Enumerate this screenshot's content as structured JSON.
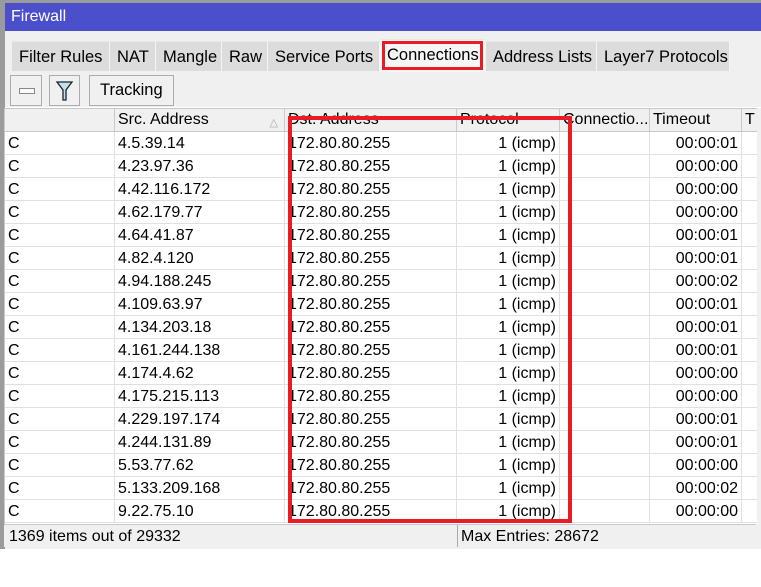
{
  "window": {
    "title": "Firewall"
  },
  "tabs": [
    {
      "label": "Filter Rules",
      "active": false
    },
    {
      "label": "NAT",
      "active": false
    },
    {
      "label": "Mangle",
      "active": false
    },
    {
      "label": "Raw",
      "active": false
    },
    {
      "label": "Service Ports",
      "active": false
    },
    {
      "label": "Connections",
      "active": true
    },
    {
      "label": "Address Lists",
      "active": false
    },
    {
      "label": "Layer7 Protocols",
      "active": false
    }
  ],
  "toolbar": {
    "remove_icon": "minus-icon",
    "filter_icon": "funnel-icon",
    "tracking_label": "Tracking"
  },
  "table": {
    "columns": [
      "",
      "Src. Address",
      "Dst. Address",
      "Protocol",
      "Connectio...",
      "Timeout",
      "T"
    ],
    "sorted_column": "Src. Address",
    "rows": [
      {
        "flag": "C",
        "src": "4.5.39.14",
        "dst": "172.80.80.255",
        "proto": "1 (icmp)",
        "conn": "",
        "timeout": "00:00:01"
      },
      {
        "flag": "C",
        "src": "4.23.97.36",
        "dst": "172.80.80.255",
        "proto": "1 (icmp)",
        "conn": "",
        "timeout": "00:00:00"
      },
      {
        "flag": "C",
        "src": "4.42.116.172",
        "dst": "172.80.80.255",
        "proto": "1 (icmp)",
        "conn": "",
        "timeout": "00:00:00"
      },
      {
        "flag": "C",
        "src": "4.62.179.77",
        "dst": "172.80.80.255",
        "proto": "1 (icmp)",
        "conn": "",
        "timeout": "00:00:00"
      },
      {
        "flag": "C",
        "src": "4.64.41.87",
        "dst": "172.80.80.255",
        "proto": "1 (icmp)",
        "conn": "",
        "timeout": "00:00:01"
      },
      {
        "flag": "C",
        "src": "4.82.4.120",
        "dst": "172.80.80.255",
        "proto": "1 (icmp)",
        "conn": "",
        "timeout": "00:00:01"
      },
      {
        "flag": "C",
        "src": "4.94.188.245",
        "dst": "172.80.80.255",
        "proto": "1 (icmp)",
        "conn": "",
        "timeout": "00:00:02"
      },
      {
        "flag": "C",
        "src": "4.109.63.97",
        "dst": "172.80.80.255",
        "proto": "1 (icmp)",
        "conn": "",
        "timeout": "00:00:01"
      },
      {
        "flag": "C",
        "src": "4.134.203.18",
        "dst": "172.80.80.255",
        "proto": "1 (icmp)",
        "conn": "",
        "timeout": "00:00:01"
      },
      {
        "flag": "C",
        "src": "4.161.244.138",
        "dst": "172.80.80.255",
        "proto": "1 (icmp)",
        "conn": "",
        "timeout": "00:00:01"
      },
      {
        "flag": "C",
        "src": "4.174.4.62",
        "dst": "172.80.80.255",
        "proto": "1 (icmp)",
        "conn": "",
        "timeout": "00:00:00"
      },
      {
        "flag": "C",
        "src": "4.175.215.113",
        "dst": "172.80.80.255",
        "proto": "1 (icmp)",
        "conn": "",
        "timeout": "00:00:00"
      },
      {
        "flag": "C",
        "src": "4.229.197.174",
        "dst": "172.80.80.255",
        "proto": "1 (icmp)",
        "conn": "",
        "timeout": "00:00:01"
      },
      {
        "flag": "C",
        "src": "4.244.131.89",
        "dst": "172.80.80.255",
        "proto": "1 (icmp)",
        "conn": "",
        "timeout": "00:00:01"
      },
      {
        "flag": "C",
        "src": "5.53.77.62",
        "dst": "172.80.80.255",
        "proto": "1 (icmp)",
        "conn": "",
        "timeout": "00:00:00"
      },
      {
        "flag": "C",
        "src": "5.133.209.168",
        "dst": "172.80.80.255",
        "proto": "1 (icmp)",
        "conn": "",
        "timeout": "00:00:02"
      },
      {
        "flag": "C",
        "src": "9.22.75.10",
        "dst": "172.80.80.255",
        "proto": "1 (icmp)",
        "conn": "",
        "timeout": "00:00:00"
      }
    ]
  },
  "status": {
    "items": "1369 items out of 29332",
    "max_entries": "Max Entries: 28672"
  },
  "colors": {
    "titlebar": "#4b4fcc",
    "highlight": "#e81c24"
  }
}
